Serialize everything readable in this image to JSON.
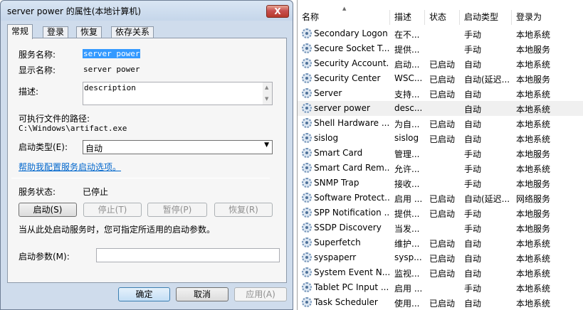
{
  "dialog": {
    "title": "server power 的属性(本地计算机)",
    "close_label": "X",
    "tabs": [
      "常规",
      "登录",
      "恢复",
      "依存关系"
    ],
    "general": {
      "service_name_label": "服务名称:",
      "service_name_value": "server power",
      "display_name_label": "显示名称:",
      "display_name_value": "server power",
      "description_label": "描述:",
      "description_value": "description",
      "path_label": "可执行文件的路径:",
      "path_value": "C:\\Windows\\artifact.exe",
      "startup_type_label": "启动类型(E):",
      "startup_type_value": "自动",
      "help_link": "帮助我配置服务启动选项。",
      "status_label": "服务状态:",
      "status_value": "已停止",
      "start_button": "启动(S)",
      "stop_button": "停止(T)",
      "pause_button": "暂停(P)",
      "resume_button": "恢复(R)",
      "hint_text": "当从此处启动服务时，您可指定所适用的启动参数。",
      "start_params_label": "启动参数(M):",
      "start_params_value": ""
    },
    "footer": {
      "ok_button": "确定",
      "cancel_button": "取消",
      "apply_button": "应用(A)"
    }
  },
  "services": {
    "columns": [
      "名称",
      "描述",
      "状态",
      "启动类型",
      "登录为"
    ],
    "rows": [
      {
        "name": "Secondary Logon",
        "desc": "在不...",
        "status": "",
        "startup": "手动",
        "logon": "本地系统"
      },
      {
        "name": "Secure Socket T...",
        "desc": "提供...",
        "status": "",
        "startup": "手动",
        "logon": "本地服务"
      },
      {
        "name": "Security Account...",
        "desc": "启动...",
        "status": "已启动",
        "startup": "自动",
        "logon": "本地系统"
      },
      {
        "name": "Security Center",
        "desc": "WSC...",
        "status": "已启动",
        "startup": "自动(延迟...",
        "logon": "本地服务"
      },
      {
        "name": "Server",
        "desc": "支持...",
        "status": "已启动",
        "startup": "自动",
        "logon": "本地系统"
      },
      {
        "name": "server power",
        "desc": "desc...",
        "status": "",
        "startup": "自动",
        "logon": "本地系统"
      },
      {
        "name": "Shell Hardware ...",
        "desc": "为自...",
        "status": "已启动",
        "startup": "自动",
        "logon": "本地系统"
      },
      {
        "name": "sislog",
        "desc": "sislog",
        "status": "已启动",
        "startup": "自动",
        "logon": "本地系统"
      },
      {
        "name": "Smart Card",
        "desc": "管理...",
        "status": "",
        "startup": "手动",
        "logon": "本地服务"
      },
      {
        "name": "Smart Card Rem...",
        "desc": "允许...",
        "status": "",
        "startup": "手动",
        "logon": "本地系统"
      },
      {
        "name": "SNMP Trap",
        "desc": "接收...",
        "status": "",
        "startup": "手动",
        "logon": "本地服务"
      },
      {
        "name": "Software Protect...",
        "desc": "启用 ...",
        "status": "已启动",
        "startup": "自动(延迟...",
        "logon": "网络服务"
      },
      {
        "name": "SPP Notification ...",
        "desc": "提供...",
        "status": "已启动",
        "startup": "手动",
        "logon": "本地服务"
      },
      {
        "name": "SSDP Discovery",
        "desc": "当发...",
        "status": "",
        "startup": "手动",
        "logon": "本地服务"
      },
      {
        "name": "Superfetch",
        "desc": "维护...",
        "status": "已启动",
        "startup": "自动",
        "logon": "本地系统"
      },
      {
        "name": "syspaperr",
        "desc": "sysp...",
        "status": "已启动",
        "startup": "自动",
        "logon": "本地系统"
      },
      {
        "name": "System Event N...",
        "desc": "监视...",
        "status": "已启动",
        "startup": "自动",
        "logon": "本地系统"
      },
      {
        "name": "Tablet PC Input ...",
        "desc": "启用 ...",
        "status": "",
        "startup": "手动",
        "logon": "本地系统"
      },
      {
        "name": "Task Scheduler",
        "desc": "使用...",
        "status": "已启动",
        "startup": "自动",
        "logon": "本地系统"
      }
    ],
    "selected_row_name": "server power"
  }
}
